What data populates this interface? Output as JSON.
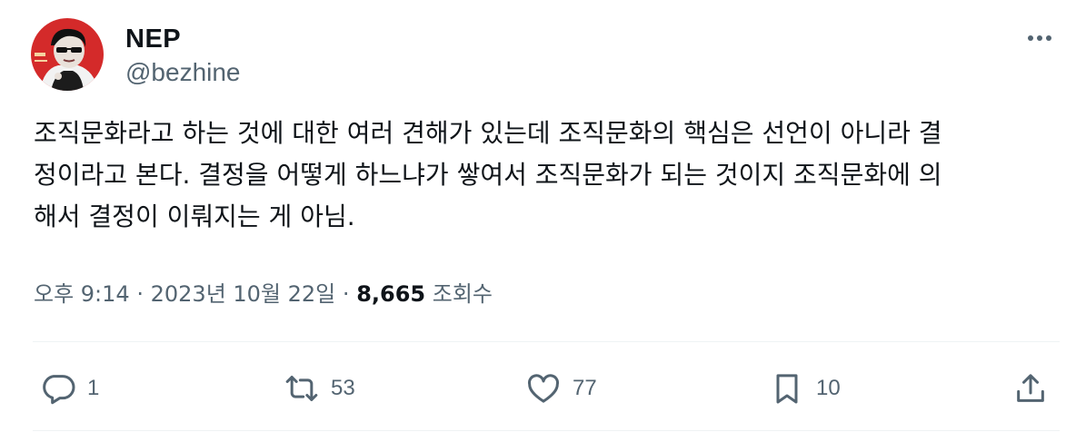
{
  "author": {
    "name": "NEP",
    "handle": "@bezhine",
    "avatar_icon": "avatar-portrait-icon"
  },
  "tweet": {
    "text": "조직문화라고 하는 것에 대한 여러 견해가 있는데 조직문화의 핵심은 선언이 아니라 결\n정이라고 본다. 결정을 어떻게 하느냐가 쌓여서 조직문화가 되는 것이지 조직문화에 의\n해서 결정이 이뤄지는 게 아님."
  },
  "meta": {
    "time": "오후 9:14",
    "separator": "·",
    "date": "2023년 10월 22일",
    "views_count": "8,665",
    "views_label": "조회수"
  },
  "actions": {
    "reply": {
      "icon": "reply-icon",
      "count": "1"
    },
    "repost": {
      "icon": "repost-icon",
      "count": "53"
    },
    "like": {
      "icon": "heart-icon",
      "count": "77"
    },
    "bookmark": {
      "icon": "bookmark-icon",
      "count": "10"
    },
    "share": {
      "icon": "share-icon"
    }
  },
  "colors": {
    "text_primary": "#0f1419",
    "text_secondary": "#536471",
    "divider": "#eff3f4",
    "avatar_bg": "#d42a2a"
  }
}
